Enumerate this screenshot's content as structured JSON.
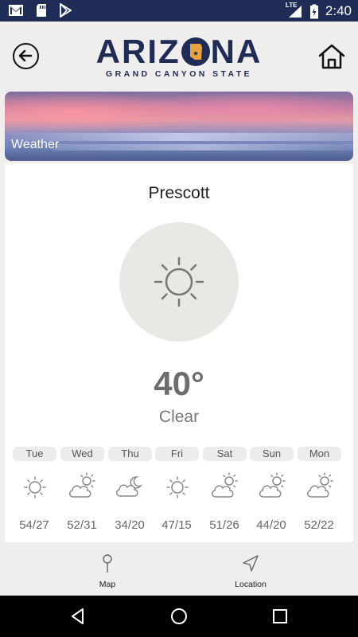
{
  "status_bar": {
    "time": "2:40",
    "network": "LTE",
    "icons": [
      "gmail-icon",
      "sd-card-icon",
      "play-store-icon",
      "signal-icon",
      "battery-icon"
    ]
  },
  "header": {
    "logo_word": "ARIZONA",
    "logo_tagline": "GRAND CANYON STATE",
    "brand_color": "#1f2c55",
    "back_icon": "arrow-left-icon",
    "home_icon": "home-icon"
  },
  "banner": {
    "label": "Weather"
  },
  "current": {
    "city": "Prescott",
    "temperature": "40°",
    "condition": "Clear",
    "icon": "sun-icon"
  },
  "forecast": [
    {
      "day": "Tue",
      "icon": "sun-icon",
      "temps": "54/27"
    },
    {
      "day": "Wed",
      "icon": "partly-cloudy-icon",
      "temps": "52/31"
    },
    {
      "day": "Thu",
      "icon": "cloudy-night-icon",
      "temps": "34/20"
    },
    {
      "day": "Fri",
      "icon": "sun-icon",
      "temps": "47/15"
    },
    {
      "day": "Sat",
      "icon": "partly-cloudy-icon",
      "temps": "51/26"
    },
    {
      "day": "Sun",
      "icon": "partly-cloudy-icon",
      "temps": "44/20"
    },
    {
      "day": "Mon",
      "icon": "partly-cloudy-icon",
      "temps": "52/22"
    }
  ],
  "bottom_nav": [
    {
      "label": "Map",
      "icon": "map-pin-icon"
    },
    {
      "label": "Location",
      "icon": "navigation-arrow-icon"
    }
  ]
}
